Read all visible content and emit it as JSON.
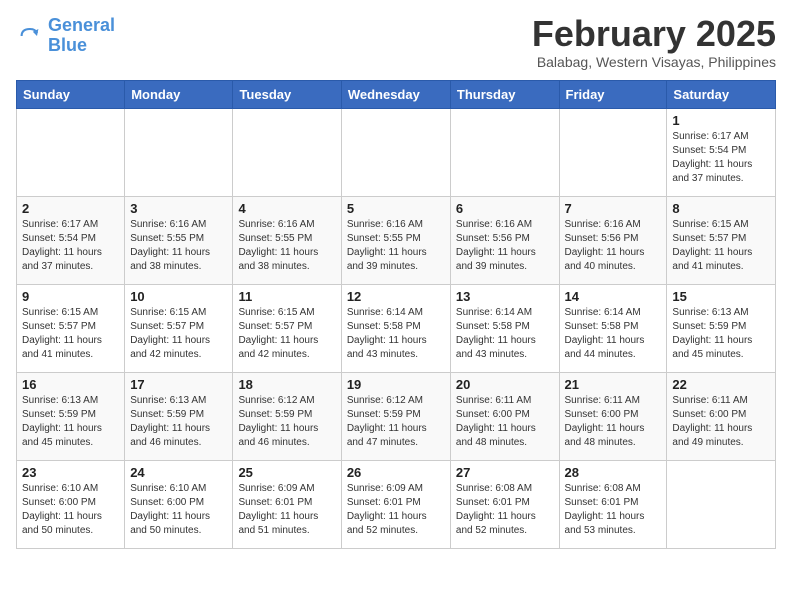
{
  "logo": {
    "line1": "General",
    "line2": "Blue"
  },
  "title": "February 2025",
  "subtitle": "Balabag, Western Visayas, Philippines",
  "weekdays": [
    "Sunday",
    "Monday",
    "Tuesday",
    "Wednesday",
    "Thursday",
    "Friday",
    "Saturday"
  ],
  "weeks": [
    [
      {
        "day": "",
        "info": ""
      },
      {
        "day": "",
        "info": ""
      },
      {
        "day": "",
        "info": ""
      },
      {
        "day": "",
        "info": ""
      },
      {
        "day": "",
        "info": ""
      },
      {
        "day": "",
        "info": ""
      },
      {
        "day": "1",
        "info": "Sunrise: 6:17 AM\nSunset: 5:54 PM\nDaylight: 11 hours\nand 37 minutes."
      }
    ],
    [
      {
        "day": "2",
        "info": "Sunrise: 6:17 AM\nSunset: 5:54 PM\nDaylight: 11 hours\nand 37 minutes."
      },
      {
        "day": "3",
        "info": "Sunrise: 6:16 AM\nSunset: 5:55 PM\nDaylight: 11 hours\nand 38 minutes."
      },
      {
        "day": "4",
        "info": "Sunrise: 6:16 AM\nSunset: 5:55 PM\nDaylight: 11 hours\nand 38 minutes."
      },
      {
        "day": "5",
        "info": "Sunrise: 6:16 AM\nSunset: 5:55 PM\nDaylight: 11 hours\nand 39 minutes."
      },
      {
        "day": "6",
        "info": "Sunrise: 6:16 AM\nSunset: 5:56 PM\nDaylight: 11 hours\nand 39 minutes."
      },
      {
        "day": "7",
        "info": "Sunrise: 6:16 AM\nSunset: 5:56 PM\nDaylight: 11 hours\nand 40 minutes."
      },
      {
        "day": "8",
        "info": "Sunrise: 6:15 AM\nSunset: 5:57 PM\nDaylight: 11 hours\nand 41 minutes."
      }
    ],
    [
      {
        "day": "9",
        "info": "Sunrise: 6:15 AM\nSunset: 5:57 PM\nDaylight: 11 hours\nand 41 minutes."
      },
      {
        "day": "10",
        "info": "Sunrise: 6:15 AM\nSunset: 5:57 PM\nDaylight: 11 hours\nand 42 minutes."
      },
      {
        "day": "11",
        "info": "Sunrise: 6:15 AM\nSunset: 5:57 PM\nDaylight: 11 hours\nand 42 minutes."
      },
      {
        "day": "12",
        "info": "Sunrise: 6:14 AM\nSunset: 5:58 PM\nDaylight: 11 hours\nand 43 minutes."
      },
      {
        "day": "13",
        "info": "Sunrise: 6:14 AM\nSunset: 5:58 PM\nDaylight: 11 hours\nand 43 minutes."
      },
      {
        "day": "14",
        "info": "Sunrise: 6:14 AM\nSunset: 5:58 PM\nDaylight: 11 hours\nand 44 minutes."
      },
      {
        "day": "15",
        "info": "Sunrise: 6:13 AM\nSunset: 5:59 PM\nDaylight: 11 hours\nand 45 minutes."
      }
    ],
    [
      {
        "day": "16",
        "info": "Sunrise: 6:13 AM\nSunset: 5:59 PM\nDaylight: 11 hours\nand 45 minutes."
      },
      {
        "day": "17",
        "info": "Sunrise: 6:13 AM\nSunset: 5:59 PM\nDaylight: 11 hours\nand 46 minutes."
      },
      {
        "day": "18",
        "info": "Sunrise: 6:12 AM\nSunset: 5:59 PM\nDaylight: 11 hours\nand 46 minutes."
      },
      {
        "day": "19",
        "info": "Sunrise: 6:12 AM\nSunset: 5:59 PM\nDaylight: 11 hours\nand 47 minutes."
      },
      {
        "day": "20",
        "info": "Sunrise: 6:11 AM\nSunset: 6:00 PM\nDaylight: 11 hours\nand 48 minutes."
      },
      {
        "day": "21",
        "info": "Sunrise: 6:11 AM\nSunset: 6:00 PM\nDaylight: 11 hours\nand 48 minutes."
      },
      {
        "day": "22",
        "info": "Sunrise: 6:11 AM\nSunset: 6:00 PM\nDaylight: 11 hours\nand 49 minutes."
      }
    ],
    [
      {
        "day": "23",
        "info": "Sunrise: 6:10 AM\nSunset: 6:00 PM\nDaylight: 11 hours\nand 50 minutes."
      },
      {
        "day": "24",
        "info": "Sunrise: 6:10 AM\nSunset: 6:00 PM\nDaylight: 11 hours\nand 50 minutes."
      },
      {
        "day": "25",
        "info": "Sunrise: 6:09 AM\nSunset: 6:01 PM\nDaylight: 11 hours\nand 51 minutes."
      },
      {
        "day": "26",
        "info": "Sunrise: 6:09 AM\nSunset: 6:01 PM\nDaylight: 11 hours\nand 52 minutes."
      },
      {
        "day": "27",
        "info": "Sunrise: 6:08 AM\nSunset: 6:01 PM\nDaylight: 11 hours\nand 52 minutes."
      },
      {
        "day": "28",
        "info": "Sunrise: 6:08 AM\nSunset: 6:01 PM\nDaylight: 11 hours\nand 53 minutes."
      },
      {
        "day": "",
        "info": ""
      }
    ]
  ]
}
